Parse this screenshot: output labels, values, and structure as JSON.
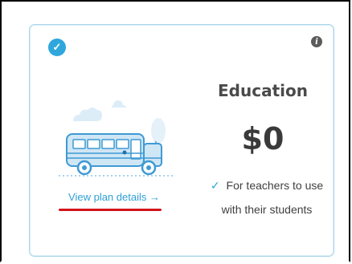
{
  "card": {
    "title": "Education",
    "price": "$0",
    "feature_line1": "For teachers to use",
    "feature_line2": "with their students",
    "check_glyph": "✓",
    "view_details_label": "View plan details →",
    "icons": [
      "check-circle-icon",
      "info-icon",
      "school-bus-illustration",
      "checkmark-icon"
    ],
    "colors": {
      "accent": "#2fa7dc",
      "border": "#a9d6ec",
      "title": "#4a4a4a",
      "annotation_underline": "#d3141a"
    }
  }
}
